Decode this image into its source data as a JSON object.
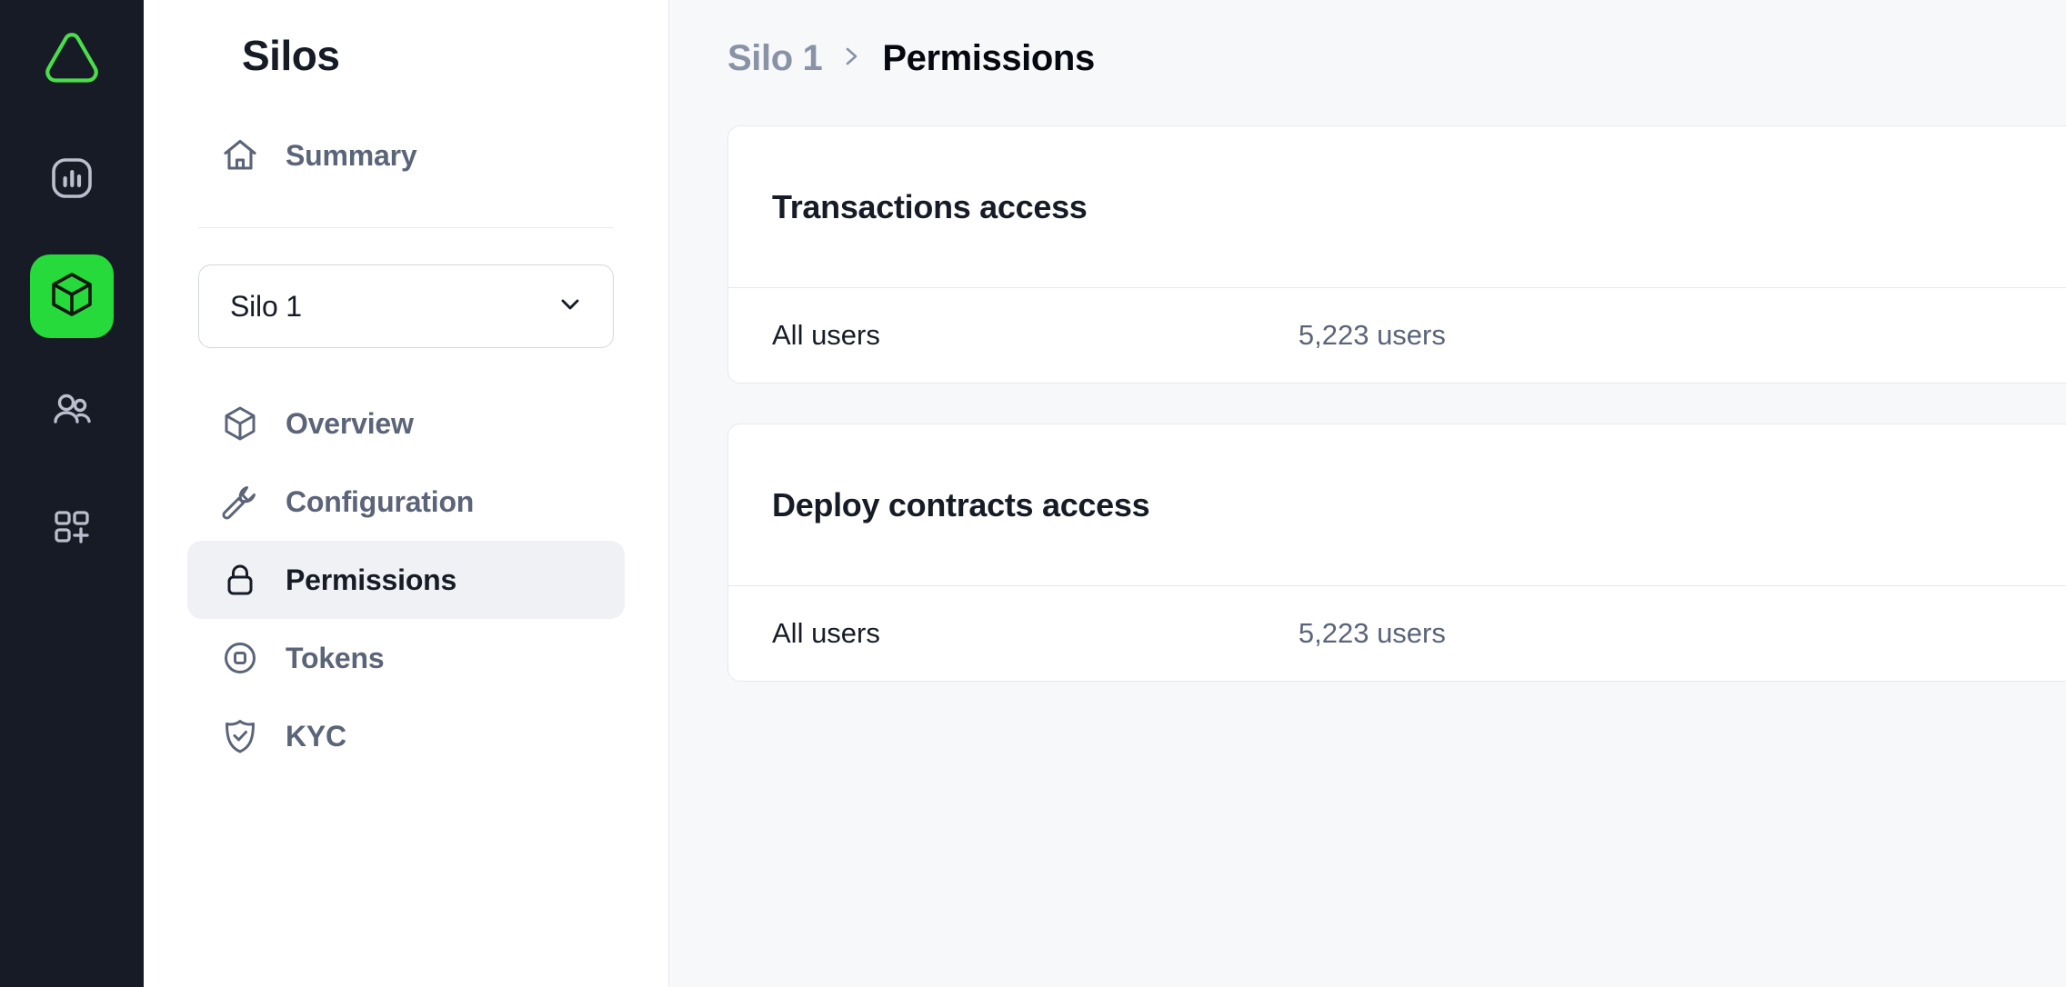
{
  "rail": {
    "logo": {
      "name": "aurora-logo",
      "color": "#4ade4a"
    },
    "items": [
      {
        "icon": "analytics-icon",
        "active": false
      },
      {
        "icon": "cube-icon",
        "active": true
      },
      {
        "icon": "users-icon",
        "active": false
      },
      {
        "icon": "apps-add-icon",
        "active": false
      }
    ],
    "active_color": "#25da3a"
  },
  "sidebar": {
    "title": "Silos",
    "top_items": [
      {
        "icon": "home-icon",
        "label": "Summary",
        "active": false
      }
    ],
    "select": {
      "value": "Silo 1",
      "icon": "chevron-down-icon"
    },
    "items": [
      {
        "icon": "cube-outline-icon",
        "label": "Overview",
        "active": false
      },
      {
        "icon": "wrench-icon",
        "label": "Configuration",
        "active": false
      },
      {
        "icon": "lock-icon",
        "label": "Permissions",
        "active": true
      },
      {
        "icon": "token-icon",
        "label": "Tokens",
        "active": false
      },
      {
        "icon": "shield-check-icon",
        "label": "KYC",
        "active": false
      }
    ]
  },
  "breadcrumb": {
    "parent": "Silo 1",
    "separator": "chevron-right-icon",
    "current": "Permissions"
  },
  "cards": [
    {
      "title": "Transactions access",
      "rows": [
        {
          "label": "All users",
          "value": "5,223 users"
        }
      ]
    },
    {
      "title": "Deploy contracts access",
      "rows": [
        {
          "label": "All users",
          "value": "5,223 users"
        }
      ]
    }
  ]
}
